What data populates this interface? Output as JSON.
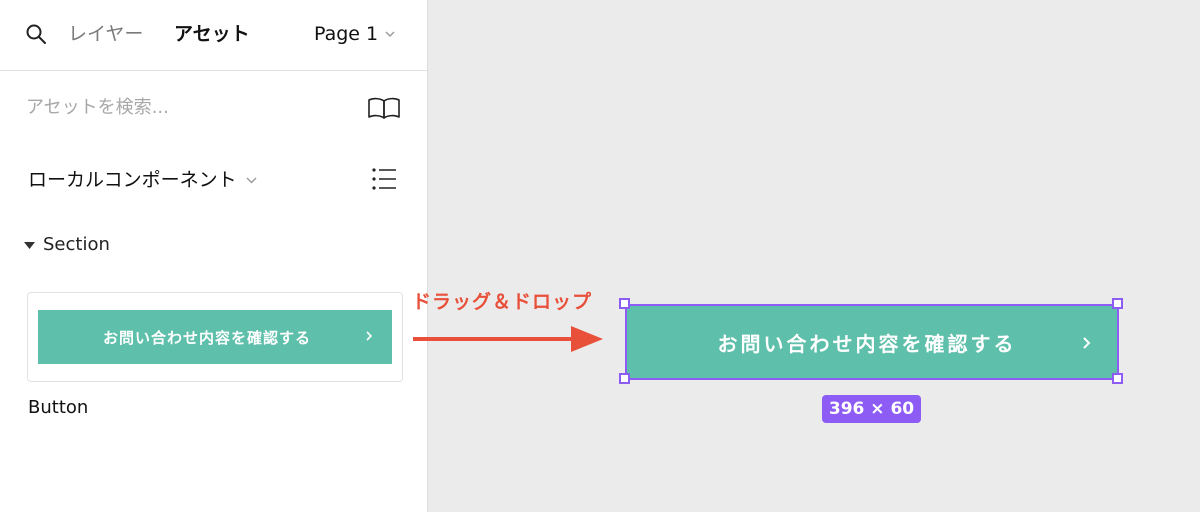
{
  "panel": {
    "tabs": {
      "layers": "レイヤー",
      "assets": "アセット"
    },
    "page_select": "Page 1",
    "search": {
      "placeholder": "アセットを検索..."
    },
    "library_select": "ローカルコンポーネント",
    "section": {
      "label": "Section"
    },
    "component": {
      "thumbnail_label": "お問い合わせ内容を確認する",
      "name": "Button"
    }
  },
  "canvas": {
    "annotation": "ドラッグ＆ドロップ",
    "button_label": "お問い合わせ内容を確認する",
    "size_badge": "396 × 60"
  },
  "colors": {
    "button_teal": "#5ebfaa",
    "selection_purple": "#8c5cf5",
    "annotation_red": "#e8503a"
  },
  "icons": [
    "search-icon",
    "chevron-down-icon",
    "book-icon",
    "list-icon",
    "caret-down-icon",
    "chevron-right-icon",
    "arrow-right-icon"
  ]
}
